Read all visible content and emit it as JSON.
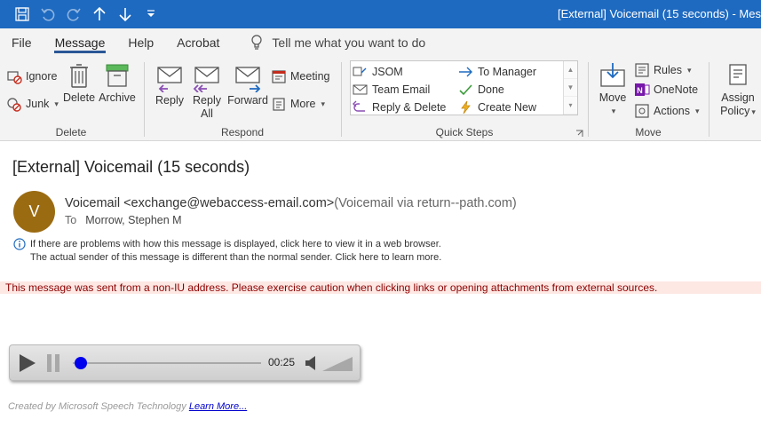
{
  "window": {
    "title": "[External] Voicemail (15 seconds)  -  Mes"
  },
  "menu": {
    "tabs": [
      "File",
      "Message",
      "Help",
      "Acrobat"
    ],
    "active_tab": "Message",
    "tell_me": "Tell me what you want to do"
  },
  "ribbon": {
    "delete_group": {
      "label": "Delete",
      "ignore": "Ignore",
      "junk": "Junk",
      "delete": "Delete",
      "archive": "Archive"
    },
    "respond_group": {
      "label": "Respond",
      "reply": "Reply",
      "reply_all_1": "Reply",
      "reply_all_2": "All",
      "forward": "Forward",
      "meeting": "Meeting",
      "more": "More"
    },
    "quick_steps": {
      "label": "Quick Steps",
      "items": [
        "JSOM",
        "Team Email",
        "Reply & Delete",
        "To Manager",
        "Done",
        "Create New"
      ]
    },
    "move_group": {
      "label": "Move",
      "move": "Move",
      "rules": "Rules",
      "onenote": "OneNote",
      "actions": "Actions"
    },
    "policy": {
      "assign_1": "Assign",
      "assign_2": "Policy"
    }
  },
  "message": {
    "subject": "[External] Voicemail (15 seconds)",
    "avatar_letter": "V",
    "avatar_color": "#9b6b12",
    "sender_name": "Voicemail <exchange@webaccess-email.com>",
    "sender_via": "(Voicemail via return--path.com)",
    "to_label": "To",
    "to": "Morrow, Stephen M",
    "info_line1": "If there are problems with how this message is displayed, click here to view it in a web browser.",
    "info_line2": "The actual sender of this message is different than the normal sender. Click here to learn more.",
    "warning": "This message was sent from a non-IU address. Please exercise caution when clicking links or opening attachments from external sources."
  },
  "player": {
    "time": "00:25",
    "progress": 0.0
  },
  "footer": {
    "text": "Created by Microsoft Speech Technology",
    "link": "Learn More..."
  }
}
